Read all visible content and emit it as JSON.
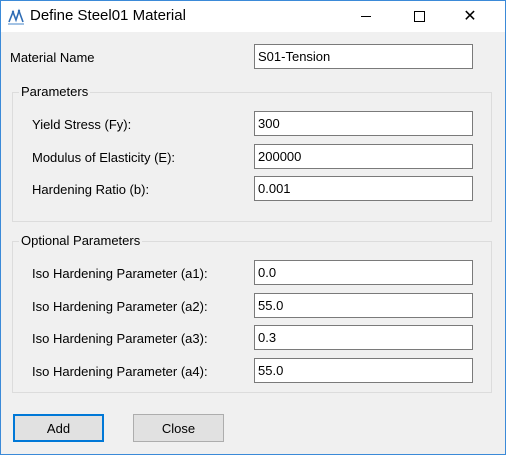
{
  "window": {
    "title": "Define Steel01 Material",
    "icon": "opensees-app-icon",
    "controls": {
      "minimize": "minimize-icon",
      "maximize": "maximize-icon",
      "close": "✕"
    }
  },
  "material": {
    "label": "Material Name",
    "value": "S01-Tension"
  },
  "parameters": {
    "title": "Parameters",
    "fields": [
      {
        "label": "Yield Stress (Fy):",
        "value": "300"
      },
      {
        "label": "Modulus of Elasticity (E):",
        "value": "200000"
      },
      {
        "label": "Hardening Ratio (b):",
        "value": "0.001"
      }
    ]
  },
  "optional": {
    "title": "Optional Parameters",
    "fields": [
      {
        "label": "Iso Hardening Parameter (a1):",
        "value": "0.0"
      },
      {
        "label": "Iso Hardening Parameter (a2):",
        "value": "55.0"
      },
      {
        "label": "Iso Hardening Parameter (a3):",
        "value": "0.3"
      },
      {
        "label": "Iso Hardening Parameter (a4):",
        "value": "55.0"
      }
    ]
  },
  "buttons": {
    "add": "Add",
    "close": "Close"
  },
  "colors": {
    "accent": "#0078d7",
    "window_border": "#3b8ad8"
  }
}
